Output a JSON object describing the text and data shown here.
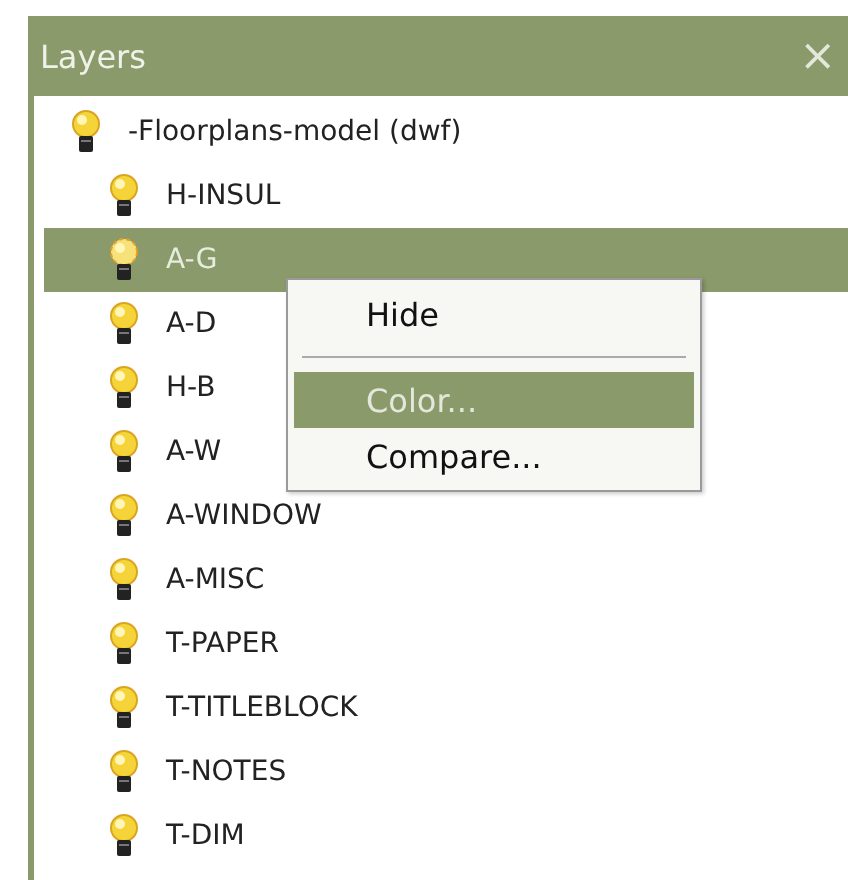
{
  "panel": {
    "title": "Layers",
    "close": "×"
  },
  "tree": {
    "label": "-Floorplans-model  (dwf)",
    "children": [
      {
        "label": "H-INSUL",
        "selected": false
      },
      {
        "label": "A-G",
        "selected": true
      },
      {
        "label": "A-D",
        "selected": false
      },
      {
        "label": "H-B",
        "selected": false
      },
      {
        "label": "A-W",
        "selected": false
      },
      {
        "label": "A-WINDOW",
        "selected": false
      },
      {
        "label": "A-MISC",
        "selected": false
      },
      {
        "label": "T-PAPER",
        "selected": false
      },
      {
        "label": "T-TITLEBLOCK",
        "selected": false
      },
      {
        "label": "T-NOTES",
        "selected": false
      },
      {
        "label": "T-DIM",
        "selected": false
      }
    ]
  },
  "context_menu": [
    {
      "kind": "item",
      "label": "Hide",
      "selected": false
    },
    {
      "kind": "separator"
    },
    {
      "kind": "item",
      "label": "Color...",
      "selected": true
    },
    {
      "kind": "item",
      "label": "Compare...",
      "selected": false
    }
  ]
}
